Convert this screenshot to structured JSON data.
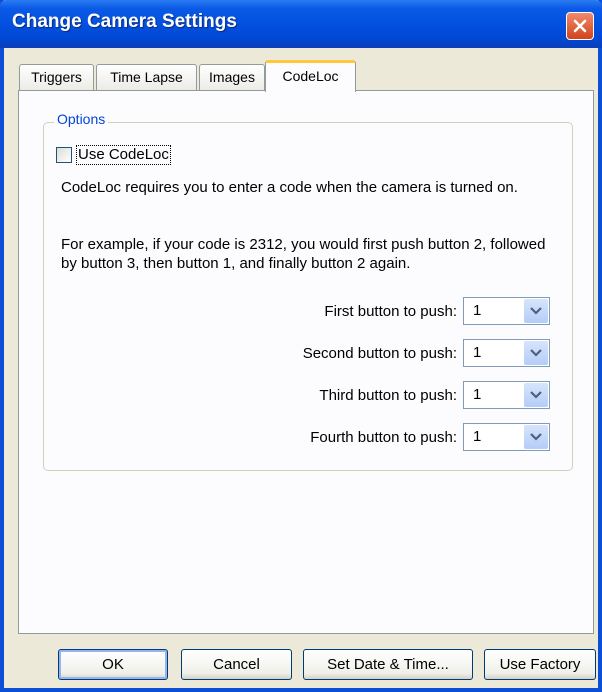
{
  "window": {
    "title": "Change Camera Settings"
  },
  "tabs": [
    {
      "label": "Triggers"
    },
    {
      "label": "Time Lapse"
    },
    {
      "label": "Images"
    },
    {
      "label": "CodeLoc",
      "active": true
    }
  ],
  "options": {
    "group_label": "Options",
    "use_codeloc_label": "Use CodeLoc",
    "use_codeloc_checked": false,
    "desc1": "CodeLoc requires you to enter a code when the camera is turned on.",
    "desc2": "For example, if your code is 2312, you would first push button 2, followed by button 3, then button 1, and finally button 2 again.",
    "rows": [
      {
        "label": "First button to push:",
        "value": "1"
      },
      {
        "label": "Second button to push:",
        "value": "1"
      },
      {
        "label": "Third button to push:",
        "value": "1"
      },
      {
        "label": "Fourth button to push:",
        "value": "1"
      }
    ]
  },
  "buttons": {
    "ok": "OK",
    "cancel": "Cancel",
    "set_date": "Set Date & Time...",
    "use_factory": "Use Factory"
  },
  "colors": {
    "title_bar": "#0350e0",
    "accent_tab": "#ffc83c",
    "group_label": "#0046d5"
  }
}
